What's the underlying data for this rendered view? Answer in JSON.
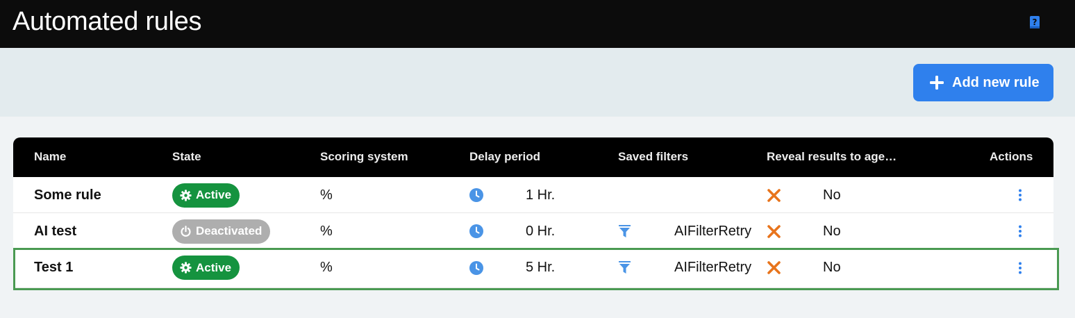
{
  "header": {
    "title": "Automated rules",
    "help_icon": "help-book-icon"
  },
  "toolbar": {
    "add_label": "Add new rule",
    "add_icon": "plus-icon"
  },
  "colors": {
    "accent": "#2f80ed",
    "active": "#15933f",
    "inactive": "#aeaeae",
    "reveal_no": "#e8741c",
    "selection": "#4a9a52"
  },
  "table": {
    "columns": {
      "name": "Name",
      "state": "State",
      "scoring": "Scoring system",
      "delay": "Delay period",
      "filters": "Saved filters",
      "reveal": "Reveal results to age…",
      "actions": "Actions"
    },
    "rows": [
      {
        "name": "Some rule",
        "state": "Active",
        "scoring": "%",
        "delay": "1 Hr.",
        "filter": "",
        "reveal": "No"
      },
      {
        "name": "AI test",
        "state": "Deactivated",
        "scoring": "%",
        "delay": "0 Hr.",
        "filter": "AIFilterRetry",
        "reveal": "No"
      },
      {
        "name": "Test 1",
        "state": "Active",
        "scoring": "%",
        "delay": "5 Hr.",
        "filter": "AIFilterRetry",
        "reveal": "No"
      }
    ]
  }
}
